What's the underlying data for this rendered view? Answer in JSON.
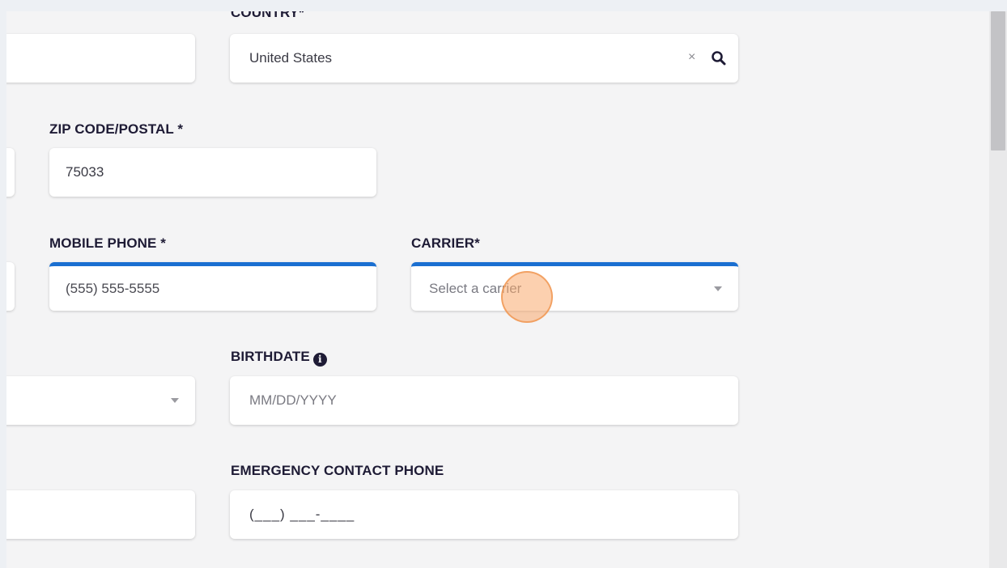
{
  "form": {
    "country": {
      "label": "COUNTRY*",
      "value": "United States",
      "clear_glyph": "×",
      "search_icon": "search-icon"
    },
    "zip": {
      "label": "ZIP CODE/POSTAL *",
      "value": "75033"
    },
    "mobile_phone": {
      "label": "MOBILE PHONE *",
      "placeholder": "(555) 555-5555"
    },
    "carrier": {
      "label": "CARRIER*",
      "placeholder": "Select a carrier",
      "dropdown_icon": "chevron-down-icon"
    },
    "birthdate": {
      "label": "BIRTHDATE",
      "info_icon": "info-icon",
      "info_glyph": "i",
      "placeholder": "MM/DD/YYYY"
    },
    "emergency_phone": {
      "label": "EMERGENCY CONTACT PHONE",
      "placeholder": "(___) ___-____"
    }
  },
  "colors": {
    "focus_accent": "#1a6fd1",
    "label_text": "#1e1b35",
    "click_indicator": "#f5a66b"
  }
}
